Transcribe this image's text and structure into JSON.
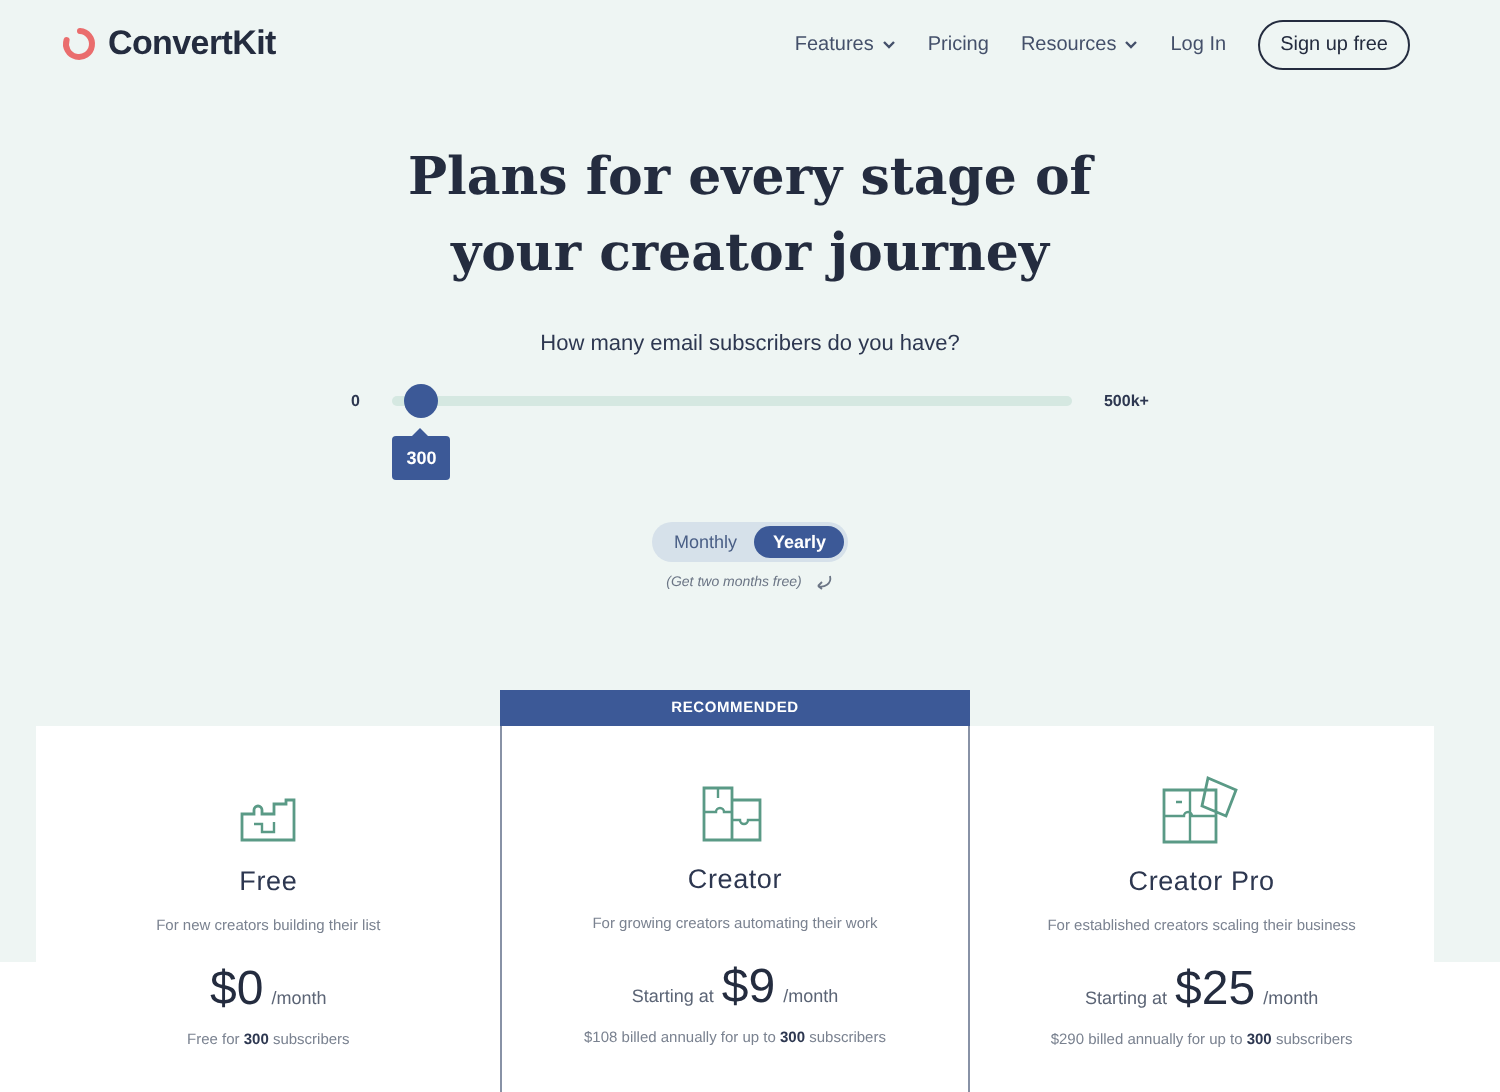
{
  "header": {
    "logo": "ConvertKit",
    "nav": [
      {
        "label": "Features",
        "dropdown": true
      },
      {
        "label": "Pricing",
        "dropdown": false
      },
      {
        "label": "Resources",
        "dropdown": true
      },
      {
        "label": "Log In",
        "dropdown": false
      }
    ],
    "cta": "Sign up free"
  },
  "hero": {
    "title_lines": [
      "Plans for every stage of",
      "your creator journey"
    ]
  },
  "slider": {
    "question": "How many email subscribers do you have?",
    "min_label": "0",
    "max_label": "500k+",
    "level": 0.04,
    "value": "300"
  },
  "billing": {
    "options": [
      {
        "label": "Monthly",
        "selected": false
      },
      {
        "label": "Yearly",
        "selected": true
      }
    ],
    "note": "(Get two months free)"
  },
  "plans": [
    {
      "name": "Free",
      "recommended": false,
      "description": "For new creators building their list",
      "price": "$0",
      "period": "/month",
      "note": "Free for **300** subscribers",
      "kind": "small"
    },
    {
      "name": "Creator",
      "recommended": true,
      "badge": "RECOMMENDED",
      "description": "For growing creators automating their work",
      "prefix": "Starting at",
      "price": "$9",
      "period": "/month",
      "note": "$108 billed annually for up to **300** subscribers",
      "kind": "medium"
    },
    {
      "name": "Creator Pro",
      "recommended": false,
      "description": "For established creators scaling their business",
      "prefix": "Starting at",
      "price": "$25",
      "period": "/month",
      "note": "$290 billed annually for up to **300** subscribers",
      "kind": "large"
    }
  ]
}
